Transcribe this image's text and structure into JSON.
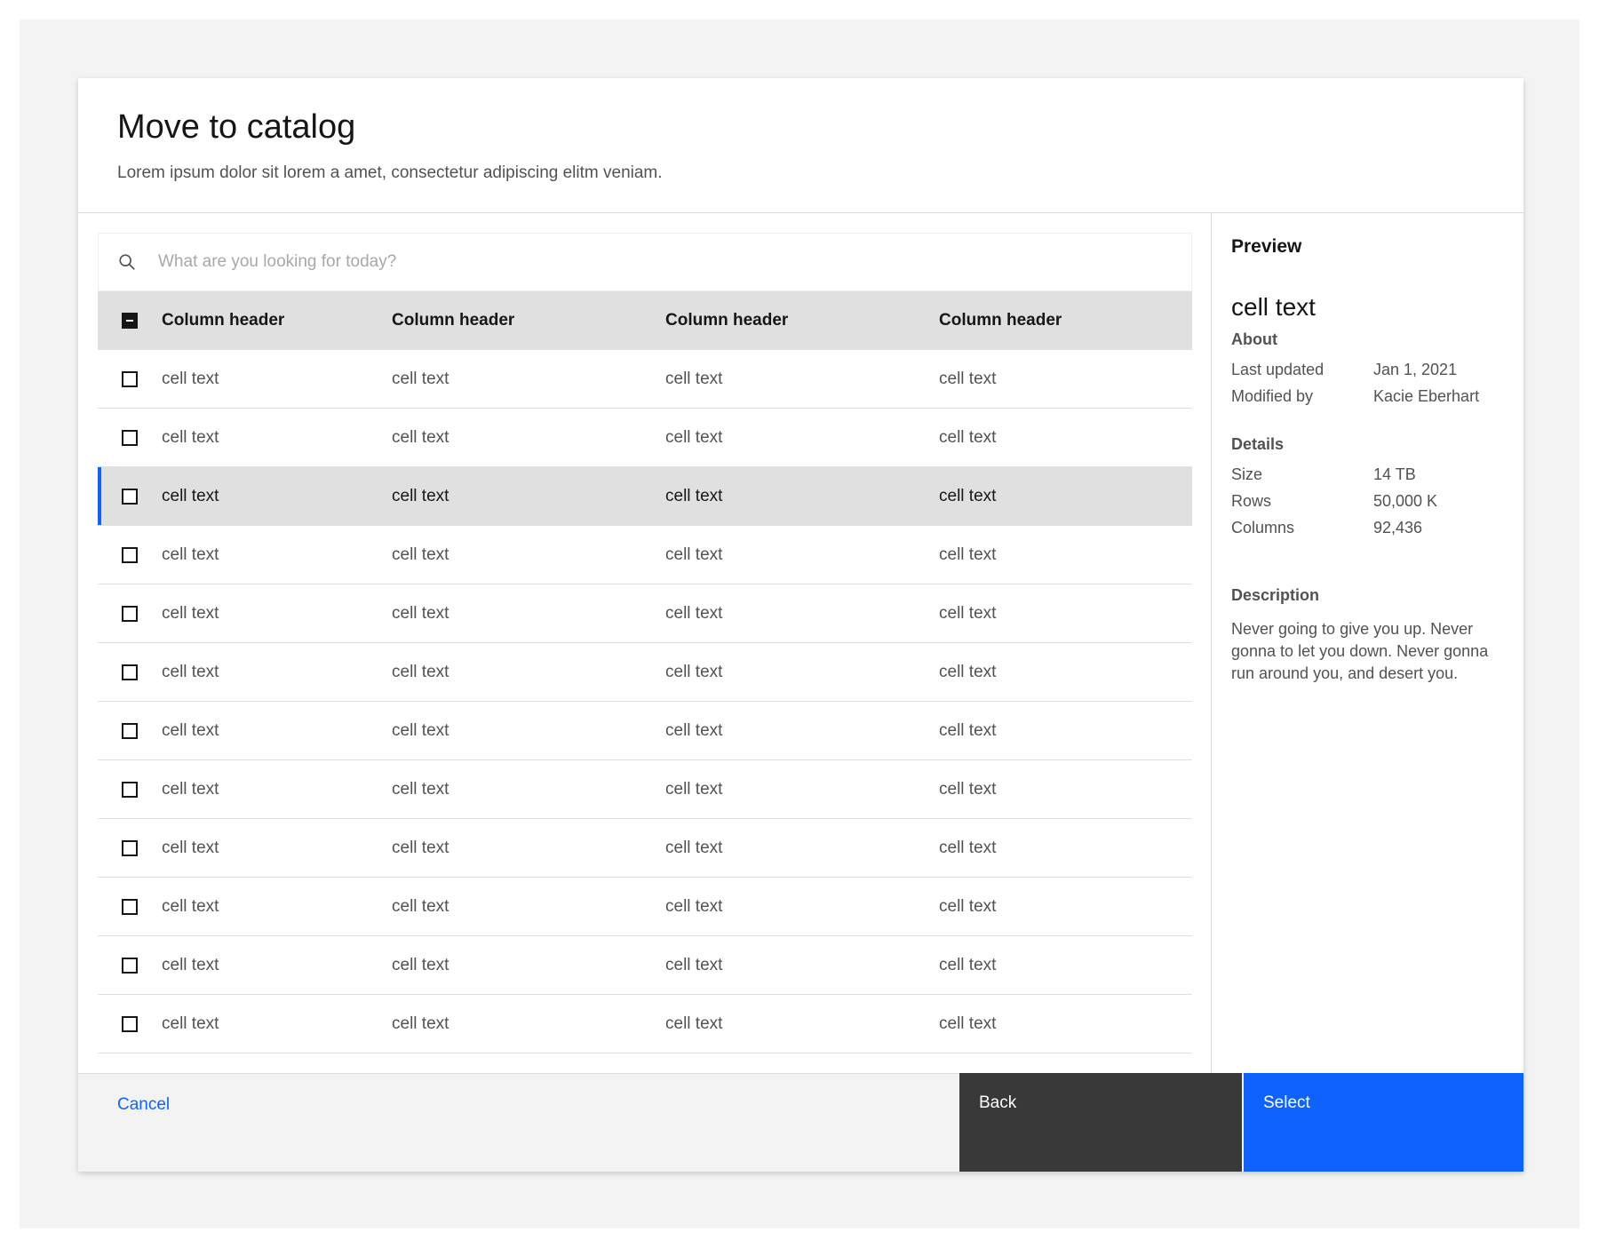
{
  "modal": {
    "title": "Move to catalog",
    "subtitle": "Lorem ipsum dolor sit lorem a amet, consectetur adipiscing elitm veniam."
  },
  "search": {
    "placeholder": "What are you looking for today?",
    "value": ""
  },
  "table": {
    "headers": [
      "Column header",
      "Column header",
      "Column header",
      "Column header"
    ],
    "rows": [
      [
        "cell text",
        "cell text",
        "cell text",
        "cell text"
      ],
      [
        "cell text",
        "cell text",
        "cell text",
        "cell text"
      ],
      [
        "cell text",
        "cell text",
        "cell text",
        "cell text"
      ],
      [
        "cell text",
        "cell text",
        "cell text",
        "cell text"
      ],
      [
        "cell text",
        "cell text",
        "cell text",
        "cell text"
      ],
      [
        "cell text",
        "cell text",
        "cell text",
        "cell text"
      ],
      [
        "cell text",
        "cell text",
        "cell text",
        "cell text"
      ],
      [
        "cell text",
        "cell text",
        "cell text",
        "cell text"
      ],
      [
        "cell text",
        "cell text",
        "cell text",
        "cell text"
      ],
      [
        "cell text",
        "cell text",
        "cell text",
        "cell text"
      ],
      [
        "cell text",
        "cell text",
        "cell text",
        "cell text"
      ],
      [
        "cell text",
        "cell text",
        "cell text",
        "cell text"
      ]
    ],
    "selected_row_index": 2,
    "header_checkbox_state": "indeterminate"
  },
  "preview": {
    "title": "Preview",
    "name": "cell text",
    "about": {
      "title": "About",
      "last_updated_label": "Last updated",
      "last_updated_value": "Jan 1, 2021",
      "modified_by_label": "Modified by",
      "modified_by_value": "Kacie Eberhart"
    },
    "details": {
      "title": "Details",
      "size_label": "Size",
      "size_value": "14 TB",
      "rows_label": "Rows",
      "rows_value": "50,000 K",
      "columns_label": "Columns",
      "columns_value": "92,436"
    },
    "description": {
      "title": "Description",
      "text": "Never going to give you up. Never gonna to let you down. Never gonna run around you, and desert you."
    }
  },
  "footer": {
    "cancel_label": "Cancel",
    "back_label": "Back",
    "select_label": "Select"
  },
  "colors": {
    "primary": "#0f62fe",
    "secondary_button": "#393939",
    "selected_row": "#e0e0e0"
  },
  "icons": {
    "search": "search-icon"
  }
}
